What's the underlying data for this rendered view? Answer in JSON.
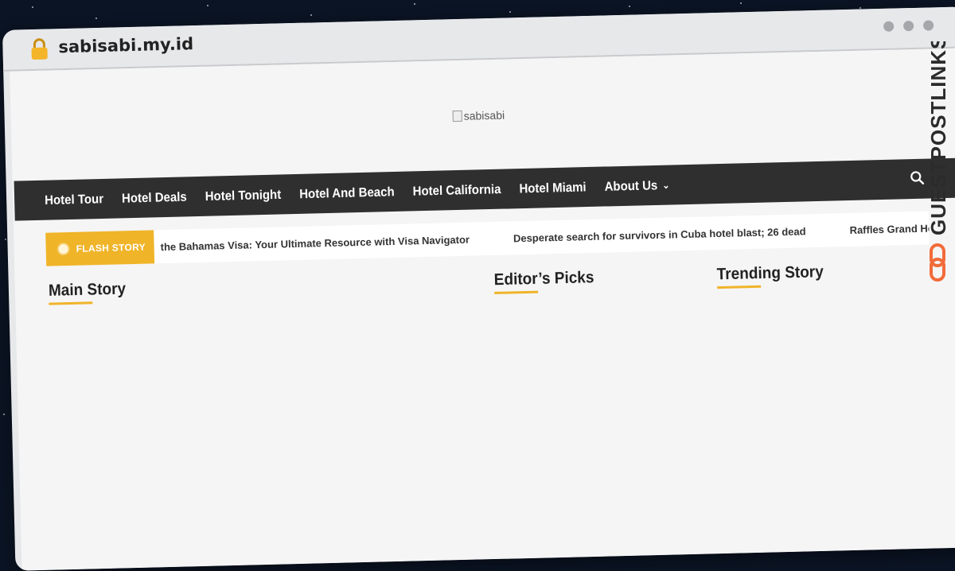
{
  "browser": {
    "url": "sabisabi.my.id"
  },
  "site": {
    "logo_alt": "sabisabi"
  },
  "nav": {
    "items": [
      {
        "label": "Hotel Tour"
      },
      {
        "label": "Hotel Deals"
      },
      {
        "label": "Hotel Tonight"
      },
      {
        "label": "Hotel And Beach"
      },
      {
        "label": "Hotel California"
      },
      {
        "label": "Hotel Miami"
      },
      {
        "label": "About Us"
      }
    ]
  },
  "ticker": {
    "badge": "FLASH STORY",
    "items": [
      "the Bahamas Visa: Your Ultimate Resource with Visa Navigator",
      "Desperate search for survivors in Cuba hotel blast; 26 dead",
      "Raffles Grand Hote"
    ]
  },
  "sections": {
    "main": "Main Story",
    "editors": "Editor’s Picks",
    "trending": "Trending Story"
  },
  "watermark": {
    "text": "GUESTPOSTLINKS"
  },
  "colors": {
    "accent": "#f0b429",
    "nav_bg": "#2f2f2f",
    "watermark": "#f26b3a"
  }
}
